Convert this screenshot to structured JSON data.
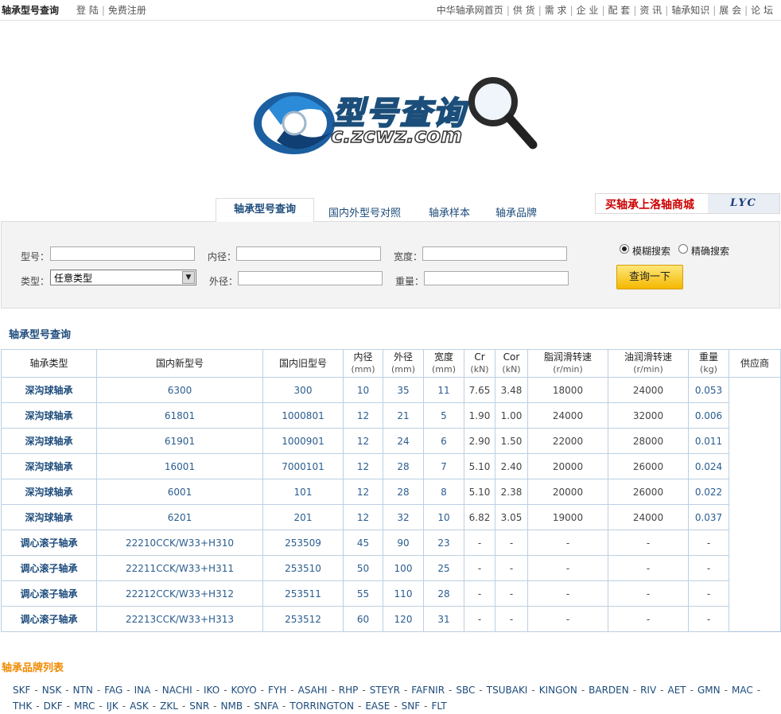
{
  "topbar": {
    "site_title": "轴承型号查询",
    "auth": [
      "登 陆",
      "免费注册"
    ],
    "nav": [
      "中华轴承网首页",
      "供 货",
      "需 求",
      "企 业",
      "配 套",
      "资 讯",
      "轴承知识",
      "展 会",
      "论 坛"
    ]
  },
  "logo": {
    "text": "型号查询",
    "url": "c.zcwz.com"
  },
  "tabs": [
    "轴承型号查询",
    "国内外型号对照",
    "轴承样本",
    "轴承品牌"
  ],
  "promo": {
    "text": "买轴承上洛轴商城",
    "brand": "LYC"
  },
  "search": {
    "model_label": "型号：",
    "model_value": "",
    "inner_label": "内径：",
    "inner_value": "",
    "width_label": "宽度：",
    "width_value": "",
    "type_label": "类型：",
    "type_selected": "任意类型",
    "outer_label": "外径：",
    "outer_value": "",
    "weight_label": "重量：",
    "weight_value": "",
    "fuzzy_label": "模糊搜索",
    "exact_label": "精确搜索",
    "selected_mode": "fuzzy",
    "button": "查询一下"
  },
  "results": {
    "title": "轴承型号查询",
    "headers": [
      {
        "label": "轴承类型",
        "unit": ""
      },
      {
        "label": "国内新型号",
        "unit": ""
      },
      {
        "label": "国内旧型号",
        "unit": ""
      },
      {
        "label": "内径",
        "unit": "(mm)"
      },
      {
        "label": "外径",
        "unit": "(mm)"
      },
      {
        "label": "宽度",
        "unit": "(mm)"
      },
      {
        "label": "Cr",
        "unit": "(kN)"
      },
      {
        "label": "Cor",
        "unit": "(kN)"
      },
      {
        "label": "脂润滑转速",
        "unit": "(r/min)"
      },
      {
        "label": "油润滑转速",
        "unit": "(r/min)"
      },
      {
        "label": "重量",
        "unit": "(kg)"
      },
      {
        "label": "供应商",
        "unit": ""
      }
    ],
    "rows": [
      [
        "深沟球轴承",
        "6300",
        "300",
        "10",
        "35",
        "11",
        "7.65",
        "3.48",
        "18000",
        "24000",
        "0.053"
      ],
      [
        "深沟球轴承",
        "61801",
        "1000801",
        "12",
        "21",
        "5",
        "1.90",
        "1.00",
        "24000",
        "32000",
        "0.006"
      ],
      [
        "深沟球轴承",
        "61901",
        "1000901",
        "12",
        "24",
        "6",
        "2.90",
        "1.50",
        "22000",
        "28000",
        "0.011"
      ],
      [
        "深沟球轴承",
        "16001",
        "7000101",
        "12",
        "28",
        "7",
        "5.10",
        "2.40",
        "20000",
        "26000",
        "0.024"
      ],
      [
        "深沟球轴承",
        "6001",
        "101",
        "12",
        "28",
        "8",
        "5.10",
        "2.38",
        "20000",
        "26000",
        "0.022"
      ],
      [
        "深沟球轴承",
        "6201",
        "201",
        "12",
        "32",
        "10",
        "6.82",
        "3.05",
        "19000",
        "24000",
        "0.037"
      ],
      [
        "调心滚子轴承",
        "22210CCK/W33+H310",
        "253509",
        "45",
        "90",
        "23",
        "-",
        "-",
        "-",
        "-",
        "-"
      ],
      [
        "调心滚子轴承",
        "22211CCK/W33+H311",
        "253510",
        "50",
        "100",
        "25",
        "-",
        "-",
        "-",
        "-",
        "-"
      ],
      [
        "调心滚子轴承",
        "22212CCK/W33+H312",
        "253511",
        "55",
        "110",
        "28",
        "-",
        "-",
        "-",
        "-",
        "-"
      ],
      [
        "调心滚子轴承",
        "22213CCK/W33+H313",
        "253512",
        "60",
        "120",
        "31",
        "-",
        "-",
        "-",
        "-",
        "-"
      ]
    ]
  },
  "brands": {
    "title": "轴承品牌列表",
    "items": [
      "SKF",
      "NSK",
      "NTN",
      "FAG",
      "INA",
      "NACHI",
      "IKO",
      "KOYO",
      "FYH",
      "ASAHI",
      "RHP",
      "STEYR",
      "FAFNIR",
      "SBC",
      "TSUBAKI",
      "KINGON",
      "BARDEN",
      "RIV",
      "AET",
      "GMN",
      "MAC",
      "THK",
      "DKF",
      "MRC",
      "IJK",
      "ASK",
      "ZKL",
      "SNR",
      "NMB",
      "SNFA",
      "TORRINGTON",
      "EASE",
      "SNF",
      "FLT"
    ]
  },
  "colors": {
    "accent": "#1c4b7b",
    "brand_title": "#f08a00",
    "promo": "#cc0000",
    "button": "#f5b800"
  }
}
